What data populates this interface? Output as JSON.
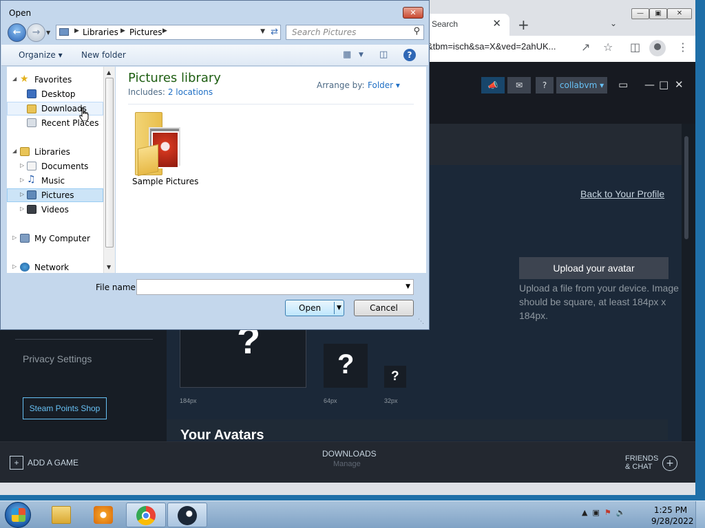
{
  "chrome": {
    "tab_title": "Search",
    "tab_close": "✕",
    "new_tab": "+",
    "url": "&tbm=isch&sa=X&ved=2ahUK..."
  },
  "steam": {
    "account": "collabvm",
    "help": "?",
    "back_to_profile": "Back to Your Profile",
    "upload_avatar": "Upload your avatar",
    "upload_desc": "Upload a file from your device. Image should be square, at least 184px x 184px.",
    "avatar_placeholder": "?",
    "size_labels": [
      "184px",
      "64px",
      "32px"
    ],
    "your_avatars": "Your Avatars",
    "privacy_settings": "Privacy Settings",
    "points_shop": "Steam Points Shop",
    "add_game": "ADD A GAME",
    "downloads": "DOWNLOADS",
    "downloads_sub": "Manage",
    "friends_line1": "FRIENDS",
    "friends_line2": "& CHAT"
  },
  "dialog": {
    "title": "Open",
    "close": "✕",
    "address": [
      "Libraries",
      "Pictures"
    ],
    "search_placeholder": "Search Pictures",
    "organize": "Organize ▾",
    "new_folder": "New folder",
    "help": "?",
    "nav": {
      "favorites": "Favorites",
      "desktop": "Desktop",
      "downloads": "Downloads",
      "recent_places": "Recent Places",
      "libraries": "Libraries",
      "documents": "Documents",
      "music": "Music",
      "pictures": "Pictures",
      "videos": "Videos",
      "my_computer": "My Computer",
      "network": "Network"
    },
    "library_title": "Pictures library",
    "includes_label": "Includes:",
    "includes_value": "2 locations",
    "arrange_label": "Arrange by:",
    "arrange_value": "Folder ▾",
    "folder_name": "Sample Pictures",
    "file_name_label": "File name:",
    "file_name_value": "",
    "open_button": "Open",
    "cancel_button": "Cancel"
  },
  "taskbar": {
    "time": "1:25 PM",
    "date": "9/28/2022"
  },
  "colors": {
    "steam_bg": "#171d25",
    "steam_link": "#67c1f5",
    "dialog_frame": "#c4d7ec",
    "library_title": "#1e5e12"
  }
}
